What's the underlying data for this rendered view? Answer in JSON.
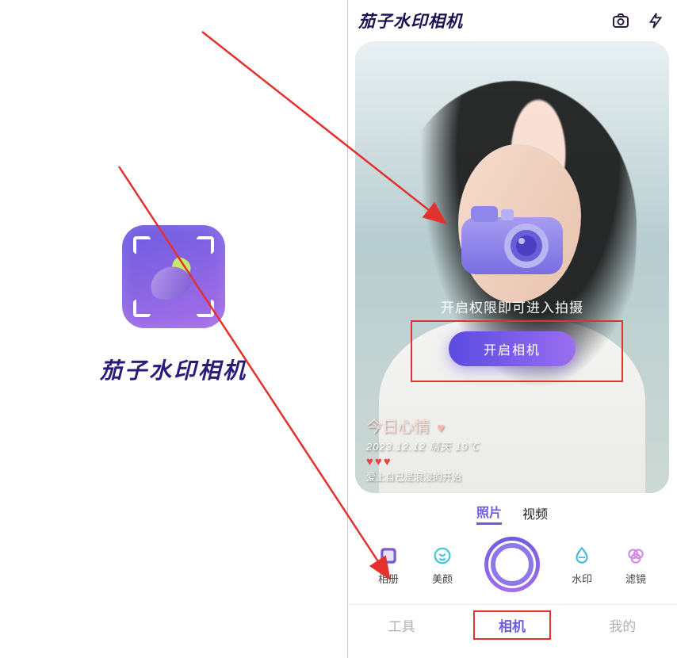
{
  "left": {
    "app_name": "茄子水印相机"
  },
  "header": {
    "title": "茄子水印相机"
  },
  "preview": {
    "permission_text": "开启权限即可进入拍摄",
    "enable_button": "开启相机",
    "watermark": {
      "mood_title": "今日心情",
      "date_line": "2023.12.12 晴天  19℃",
      "caption": "爱上自己是浪浸的开始"
    }
  },
  "mode_tabs": {
    "photo": "照片",
    "video": "视频"
  },
  "tools": {
    "album": "相册",
    "beauty": "美颜",
    "watermark": "水印",
    "filter": "滤镜"
  },
  "bottom_nav": {
    "tools": "工具",
    "camera": "相机",
    "mine": "我的"
  }
}
